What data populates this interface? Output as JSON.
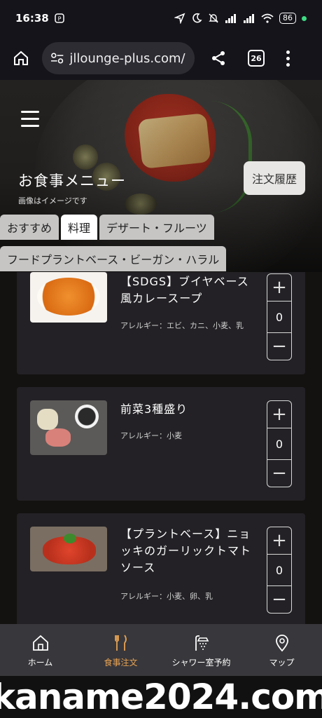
{
  "status_bar": {
    "time": "16:38",
    "battery": "86"
  },
  "browser": {
    "url": "jllounge-plus.com/r",
    "tab_count": "26"
  },
  "hero": {
    "title": "お食事メニュー",
    "note": "画像はイメージです",
    "history_button": "注文履歴"
  },
  "tabs": [
    {
      "label": "おすすめ"
    },
    {
      "label": "料理"
    },
    {
      "label": "デザート・フルーツ"
    },
    {
      "label": "フードプラントベース・ビーガン・ハラル"
    }
  ],
  "menu_items": [
    {
      "name": "【SDGS】ブイヤベース風カレースープ",
      "allergy": "アレルギー：エビ、カニ、小麦、乳",
      "quantity": "0"
    },
    {
      "name": "前菜3種盛り",
      "allergy": "アレルギー：小麦",
      "quantity": "0"
    },
    {
      "name": "【プラントベース】ニョッキのガーリックトマトソース",
      "allergy": "アレルギー：小麦、卵、乳",
      "quantity": "0"
    }
  ],
  "stepper": {
    "plus": "+",
    "minus": "−"
  },
  "bottom_nav": [
    {
      "label": "ホーム",
      "icon": "home-icon"
    },
    {
      "label": "食事注文",
      "icon": "cutlery-icon"
    },
    {
      "label": "シャワー室予約",
      "icon": "shower-icon"
    },
    {
      "label": "マップ",
      "icon": "map-pin-icon"
    }
  ],
  "watermark": "kaname2024.com",
  "colors": {
    "accent": "#e6a253",
    "card": "#232125",
    "nav": "#38373b"
  }
}
